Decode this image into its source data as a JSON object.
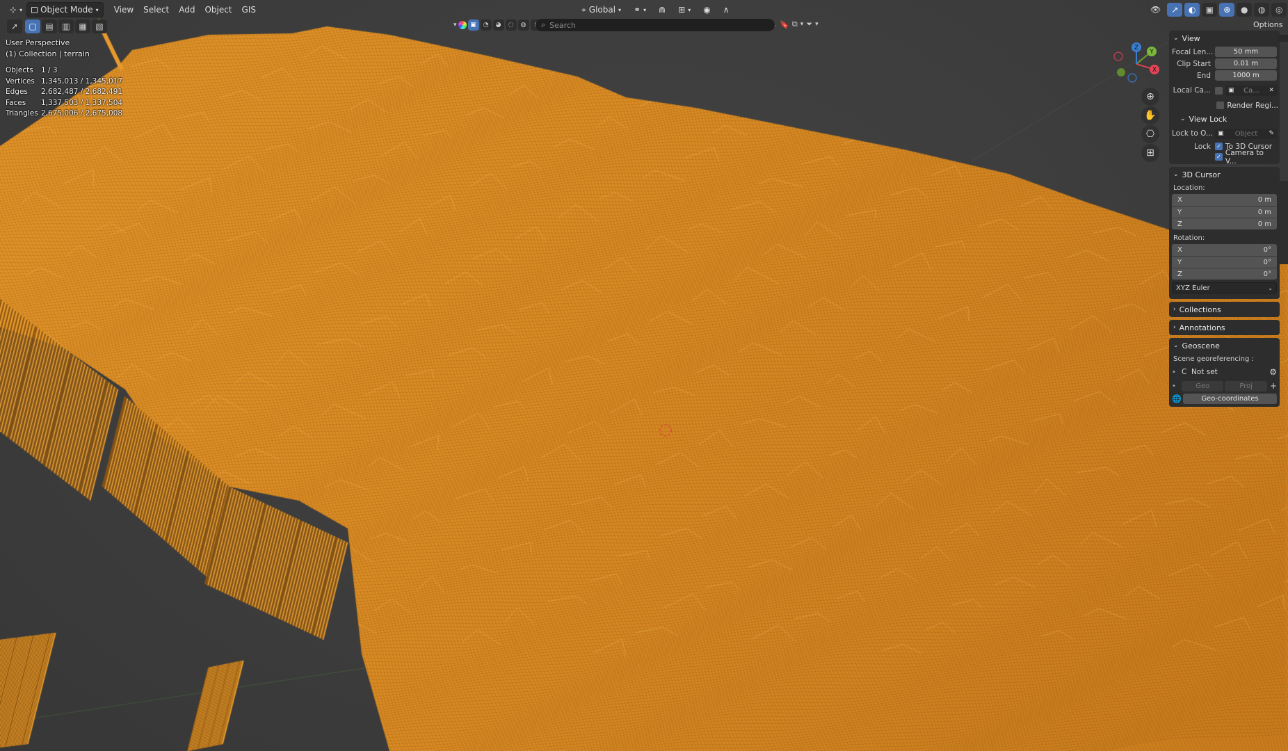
{
  "header": {
    "editor_icon": "3d-viewport-icon",
    "mode": "Object Mode",
    "menus": [
      "View",
      "Select",
      "Add",
      "Object",
      "GIS"
    ],
    "transform_orientation": "Global",
    "options_label": "Options"
  },
  "search": {
    "placeholder": "Search"
  },
  "overlay": {
    "perspective": "User Perspective",
    "collection": "(1) Collection | terrain"
  },
  "stats": [
    {
      "label": "Objects",
      "value": "1 / 3"
    },
    {
      "label": "Vertices",
      "value": "1,345,013 / 1,345,017"
    },
    {
      "label": "Edges",
      "value": "2,682,487 / 2,682,491"
    },
    {
      "label": "Faces",
      "value": "1,337,503 / 1,337,504"
    },
    {
      "label": "Triangles",
      "value": "2,675,006 / 2,675,008"
    }
  ],
  "gizmo": {
    "x": "X",
    "y": "Y",
    "z": "Z"
  },
  "sidebar": {
    "view": {
      "title": "View",
      "focal_label": "Focal Len...",
      "focal_value": "50 mm",
      "clip_start_label": "Clip Start",
      "clip_start_value": "0.01 m",
      "end_label": "End",
      "end_value": "1000 m",
      "local_camera_label": "Local Ca...",
      "local_camera_value": "Ca...",
      "render_region_label": "Render Regi...",
      "view_lock_title": "View Lock",
      "lock_to_label": "Lock to O...",
      "lock_to_placeholder": "Object",
      "lock_label": "Lock",
      "to_cursor_label": "To 3D Cursor",
      "camera_to_view_label": "Camera to V..."
    },
    "cursor": {
      "title": "3D Cursor",
      "location_label": "Location:",
      "loc": [
        {
          "axis": "X",
          "value": "0 m"
        },
        {
          "axis": "Y",
          "value": "0 m"
        },
        {
          "axis": "Z",
          "value": "0 m"
        }
      ],
      "rotation_label": "Rotation:",
      "rot": [
        {
          "axis": "X",
          "value": "0°"
        },
        {
          "axis": "Y",
          "value": "0°"
        },
        {
          "axis": "Z",
          "value": "0°"
        }
      ],
      "rotation_mode": "XYZ Euler"
    },
    "collections_title": "Collections",
    "annotations_title": "Annotations",
    "geoscene": {
      "title": "Geoscene",
      "georef_label": "Scene georeferencing :",
      "crs_letter": "C",
      "crs_value": "Not set",
      "geo_label": "Geo",
      "proj_label": "Proj",
      "geocoords_button": "Geo-coordinates"
    }
  },
  "colors": {
    "terrain": "#f0a030",
    "background": "#3a3a3a",
    "accent": "#4772b3"
  }
}
